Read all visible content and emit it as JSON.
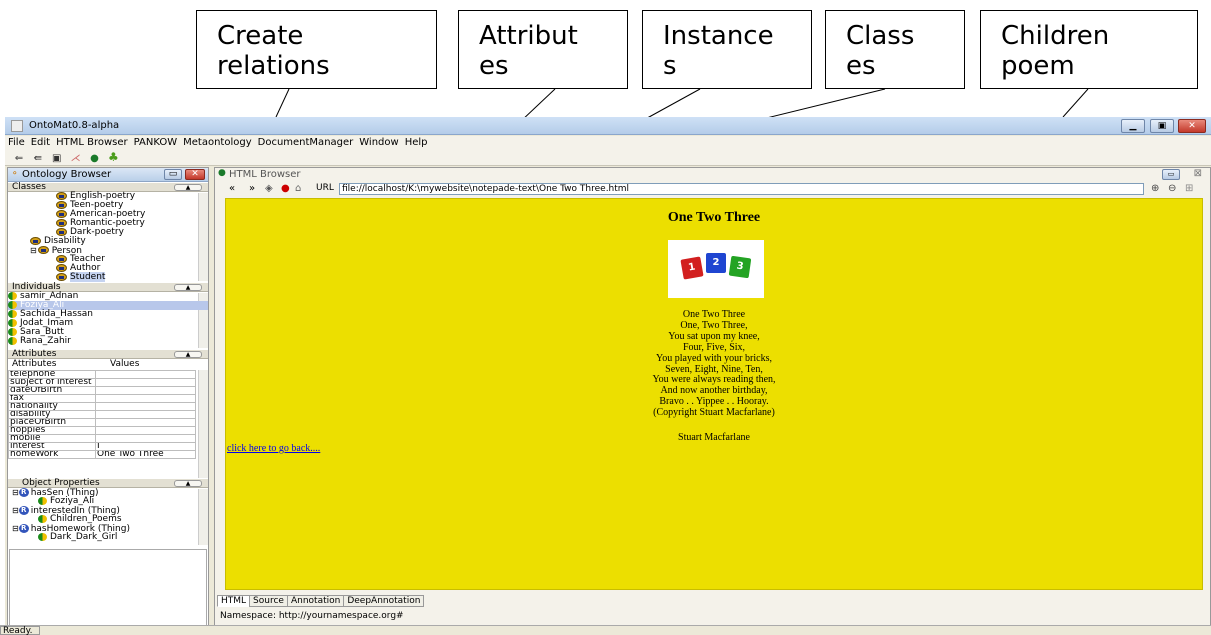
{
  "callouts": [
    "Create\nrelations",
    "Attribut\nes",
    "Instance\ns",
    "Class\nes",
    "Children\npoem"
  ],
  "window": {
    "title": "OntoMat0.8-alpha",
    "controls": [
      "minimize",
      "restore",
      "close"
    ]
  },
  "menu": [
    "File",
    "Edit",
    "HTML Browser",
    "PANKOW",
    "Metaontology",
    "DocumentManager",
    "Window",
    "Help"
  ],
  "toolbar_icons": [
    "undo-icon",
    "redo-icon",
    "save-icon",
    "pankow-icon",
    "globe-icon",
    "frog-icon"
  ],
  "ontology_browser": {
    "title": "Ontology Browser",
    "classes": {
      "header": "Classes",
      "items": [
        "English-poetry",
        "Teen-poetry",
        "American-poetry",
        "Romantic-poetry",
        "Dark-poetry",
        "Disability",
        "Person",
        "Teacher",
        "Author",
        "Student"
      ]
    },
    "individuals": {
      "header": "Individuals",
      "items": [
        "samir_Adnan",
        "Foziya_Ali",
        "Sachida_Hassan",
        "Jodat_Imam",
        "Sara_Butt",
        "Rana_Zahir"
      ]
    },
    "attributes": {
      "header": "Attributes",
      "col_attr": "Attributes",
      "col_val": "Values",
      "rows": [
        [
          "telephone",
          ""
        ],
        [
          "subject of interest",
          ""
        ],
        [
          "dateOfBirth",
          ""
        ],
        [
          "fax",
          ""
        ],
        [
          "nationality",
          ""
        ],
        [
          "disability",
          ""
        ],
        [
          "placeOfBirth",
          ""
        ],
        [
          "hoppies",
          ""
        ],
        [
          "mobile",
          ""
        ],
        [
          "interest",
          "I"
        ],
        [
          "homeWork",
          "One Two Three"
        ]
      ]
    },
    "object_properties": {
      "header": "Object Properties",
      "items": [
        {
          "prop": "hasSen (Thing)",
          "value": "Foziya_Ali"
        },
        {
          "prop": "interestedIn (Thing)",
          "value": "Children_Poems"
        },
        {
          "prop": "hasHomework (Thing)",
          "value": "Dark_Dark_Girl"
        }
      ]
    }
  },
  "html_browser": {
    "title": "HTML Browser",
    "url_label": "URL",
    "url": "file://localhost/K:\\mywebsite\\notepade-text\\One Two Three.html",
    "page": {
      "title": "One Two Three",
      "dice": [
        "1",
        "2",
        "3"
      ],
      "poem": [
        "One Two Three",
        "One, Two Three,",
        "You sat upon my knee,",
        "Four, Five, Six,",
        "You played with your bricks,",
        "Seven, Eight, Nine, Ten,",
        "You were always reading then,",
        "And now another birthday,",
        "Bravo . . Yippee . . Hooray.",
        "(Copyright Stuart Macfarlane)"
      ],
      "author": "Stuart Macfarlane",
      "back_link": "click here to go back...."
    },
    "tabs": [
      "HTML",
      "Source",
      "Annotation",
      "DeepAnnotation"
    ],
    "active_tab": "HTML",
    "namespace": "Namespace: http://yournamespace.org#"
  },
  "status": "Ready.",
  "colors": {
    "page_bg": "#ecdf00",
    "dice": [
      "#d21f1f",
      "#1f45d1",
      "#23a323"
    ]
  }
}
